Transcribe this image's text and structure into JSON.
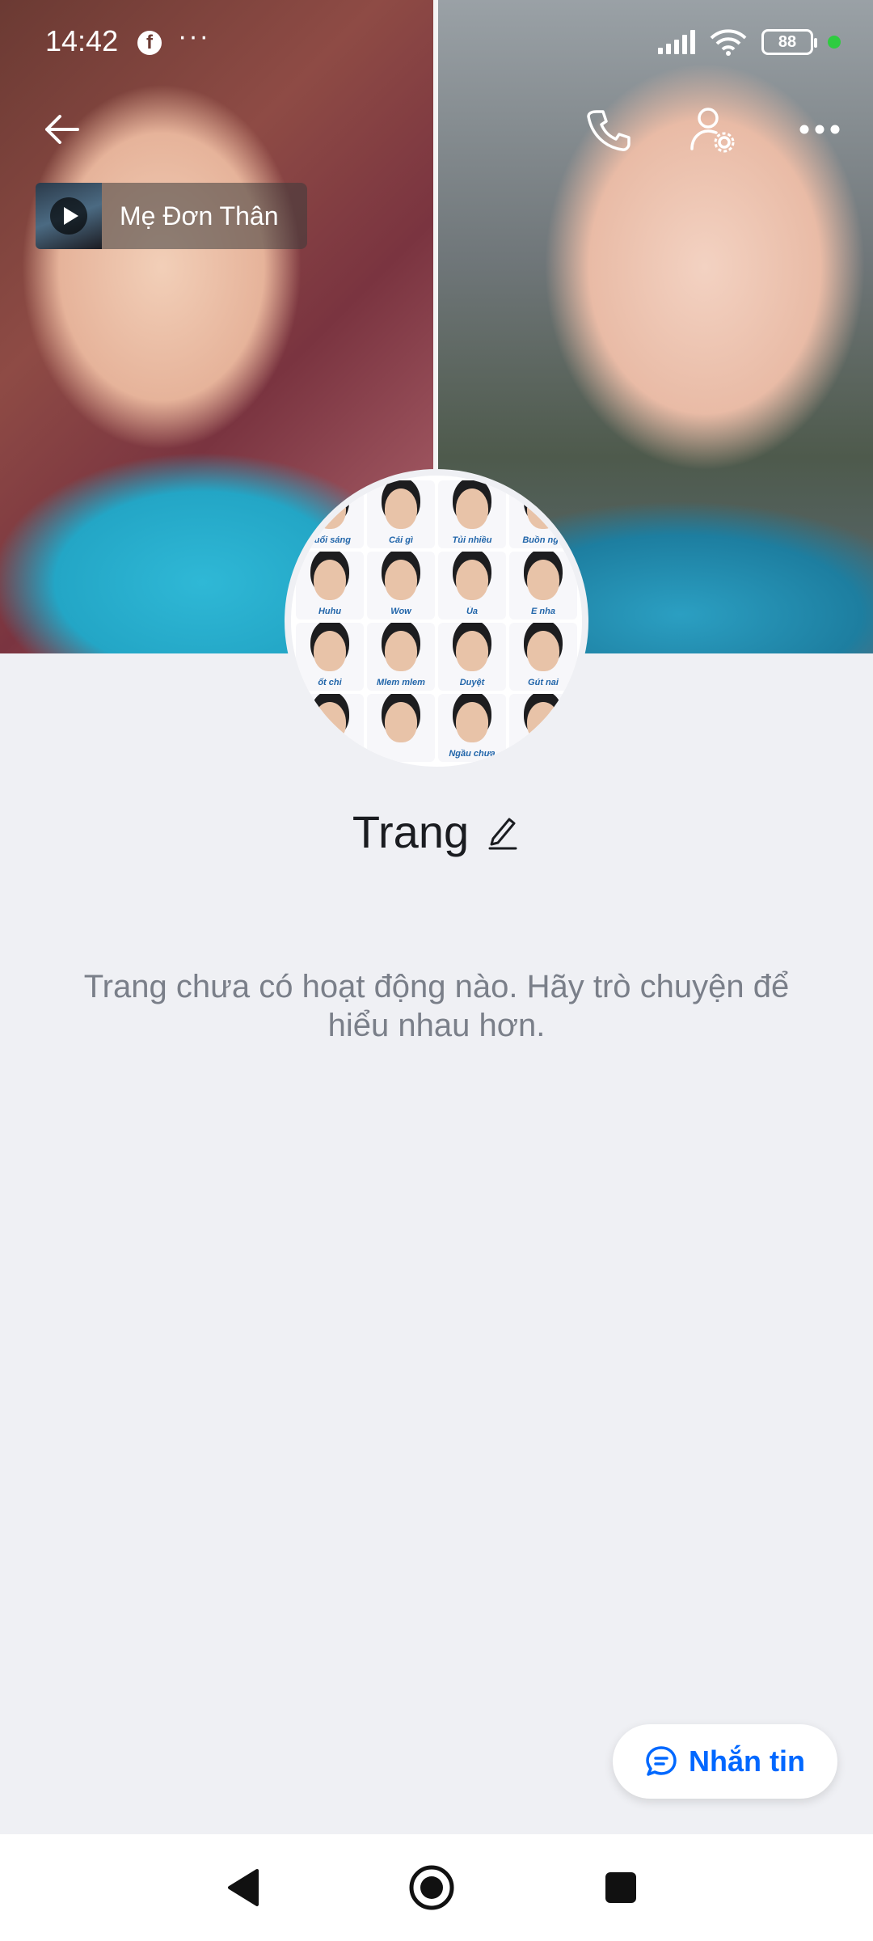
{
  "status_bar": {
    "time": "14:42",
    "app_icon": "facebook-icon",
    "overflow": "···",
    "battery": "88",
    "colors": {
      "dot": "#2ecc40"
    }
  },
  "header": {
    "back_icon": "arrow-left-icon",
    "call_icon": "phone-icon",
    "settings_icon": "user-settings-icon",
    "more_icon": "more-horizontal-icon"
  },
  "music": {
    "title": "Mẹ Đơn Thân"
  },
  "avatar": {
    "stickers": [
      "buổi sáng",
      "Cái gì",
      "Tủi nhiều",
      "Buồn ngủ",
      "Huhu",
      "Wow",
      "Ủa",
      "E nha",
      "ốt chi",
      "Mlem mlem",
      "Duyệt",
      "Gút nai",
      "",
      "",
      "Ngầu chưa",
      ""
    ]
  },
  "profile": {
    "name": "Trang",
    "empty_message": "Trang chưa có hoạt động nào. Hãy trò chuyện để hiểu nhau hơn."
  },
  "actions": {
    "message_label": "Nhắn tin",
    "accent_color": "#0068ff"
  },
  "navbar": {
    "back": "back-triangle-icon",
    "home": "home-circle-icon",
    "recents": "recents-square-icon"
  }
}
